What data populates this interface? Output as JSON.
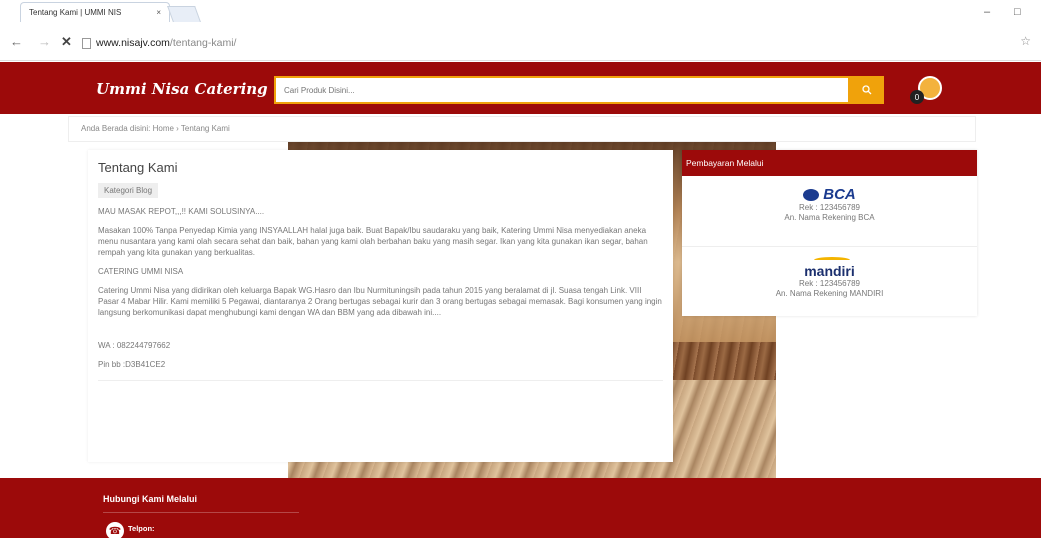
{
  "browser": {
    "tab_title": "Tentang Kami | UMMI NIS",
    "tab_close": "×",
    "url_domain": "www.nisajv.com",
    "url_path": "/tentang-kami/",
    "back": "←",
    "forward": "→",
    "stop": "✕",
    "star": "☆",
    "minimize": "–",
    "maximize": "□"
  },
  "header": {
    "logo": "Ummi Nisa Catering",
    "search_placeholder": "Cari Produk Disini...",
    "search_icon": "search-icon",
    "cart_count": "0",
    "brand_color": "#9c0a0a",
    "accent_color": "#f0a20b"
  },
  "breadcrumb": {
    "text": "Anda Berada disini: Home › Tentang Kami"
  },
  "main": {
    "title": "Tentang Kami",
    "category": "Kategori Blog",
    "p1": "MAU MASAK REPOT,,,!! KAMI SOLUSINYA....",
    "p2": "Masakan 100% Tanpa  Penyedap Kimia yang INSYAALLAH halal juga baik. Buat Bapak/Ibu saudaraku yang baik, Katering Ummi Nisa menyediakan aneka menu nusantara yang kami olah secara sehat dan baik, bahan yang kami olah berbahan baku yang masih segar. Ikan yang kita gunakan ikan segar, bahan rempah yang kita gunakan yang berkualitas.",
    "p3": "CATERING UMMI NISA",
    "p4": "Catering Ummi Nisa yang didirikan oleh keluarga Bapak WG.Hasro dan Ibu  Nurmituningsih pada tahun 2015 yang beralamat di jl. Suasa tengah Link. VIII Pasar 4 Mabar Hilir. Kami memiliki 5 Pegawai, diantaranya 2 Orang bertugas sebagai kurir dan 3 orang bertugas sebagai memasak. Bagi konsumen yang ingin langsung berkomunikasi dapat menghubungi kami dengan WA dan BBM yang ada dibawah ini....",
    "wa": "WA : 082244797662",
    "pin": "Pin bb :D3B41CE2"
  },
  "payment": {
    "heading": "Pembayaran Melalui",
    "banks": [
      {
        "logo": "BCA",
        "rek": "Rek : 123456789",
        "name": "An. Nama Rekening BCA"
      },
      {
        "logo": "mandiri",
        "rek": "Rek : 123456789",
        "name": "An. Nama Rekening MANDIRI"
      }
    ]
  },
  "footer": {
    "heading": "Hubungi Kami Melalui",
    "phone_label": "Telpon:"
  }
}
